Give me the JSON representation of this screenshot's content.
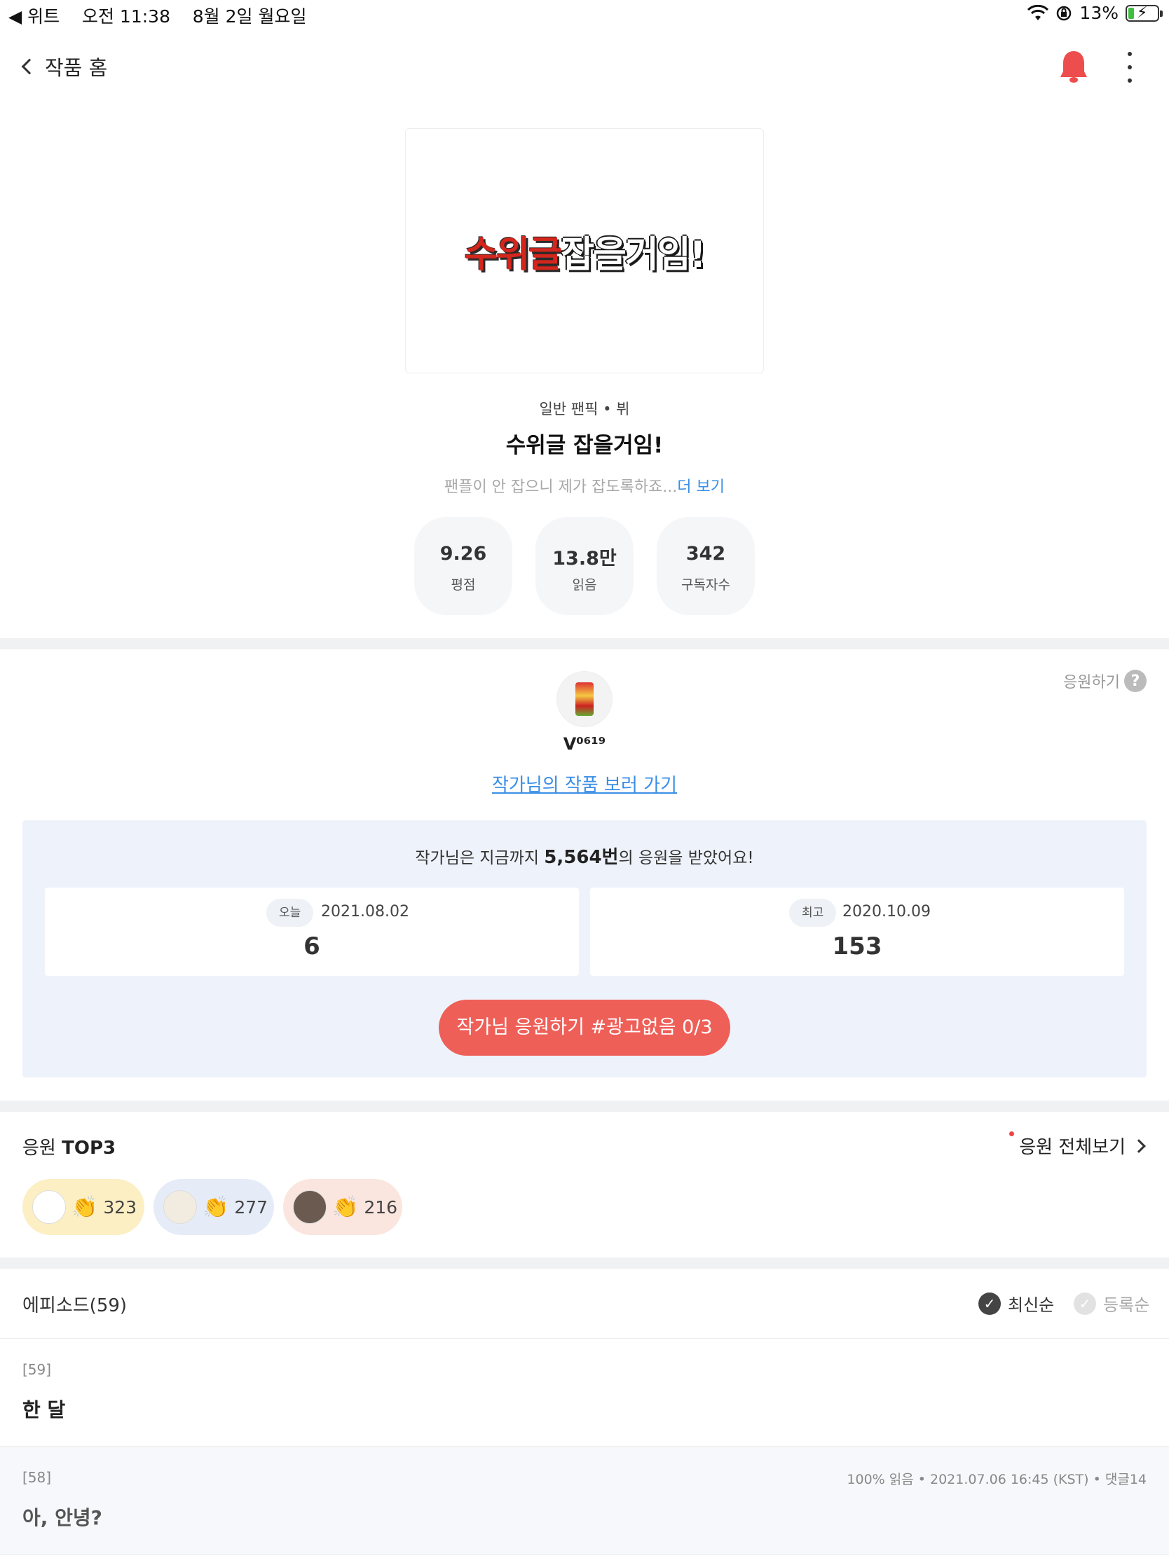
{
  "status_bar": {
    "back_app": "◀ 위트",
    "time": "오전 11:38",
    "date": "8월 2일 월요일",
    "battery": "13%"
  },
  "nav": {
    "back_label": "작품 홈"
  },
  "work": {
    "genre": "일반 팬픽 • 뷔",
    "title": "수위글 잡을거임!",
    "cover_title_red": "수위글",
    "cover_title_dark": "잡을거임!",
    "description": "팬플이 안 잡으니 제가 잡도록하죠...",
    "more_label": "더 보기",
    "stats": [
      {
        "value": "9.26",
        "label": "평점"
      },
      {
        "value": "13.8만",
        "label": "읽음"
      },
      {
        "value": "342",
        "label": "구독자수"
      }
    ]
  },
  "cheer": {
    "help_label": "응원하기",
    "author_name": "V⁰⁶¹⁹",
    "author_link": "작가님의 작품 보러 가기",
    "total_prefix": "작가님은 지금까지 ",
    "total_count": "5,564번",
    "total_suffix": "의 응원을 받았어요!",
    "today": {
      "badge": "오늘",
      "date": "2021.08.02",
      "count": "6"
    },
    "best": {
      "badge": "최고",
      "date": "2020.10.09",
      "count": "153"
    },
    "button_label": "작가님 응원하기 #광고없음 0/3"
  },
  "top3": {
    "title_prefix": "응원 ",
    "title_bold": "TOP3",
    "see_all": "응원 전체보기",
    "supporters": [
      {
        "count": "323",
        "bg": "#fcefc4"
      },
      {
        "count": "277",
        "bg": "#e6ecf7"
      },
      {
        "count": "216",
        "bg": "#fbe5df"
      }
    ]
  },
  "episodes": {
    "header": "에피소드(59)",
    "sort_latest": "최신순",
    "sort_registered": "등록순",
    "items": [
      {
        "no": "[59]",
        "title": "한 달",
        "meta": ""
      },
      {
        "no": "[58]",
        "title": "아, 안녕?",
        "meta": "100% 읽음 • 2021.07.06 16:45 (KST) • 댓글14"
      }
    ]
  },
  "colors": {
    "accent_red": "#ee5f58",
    "link_blue": "#3a8ee6",
    "bell": "#ee4d4d"
  }
}
